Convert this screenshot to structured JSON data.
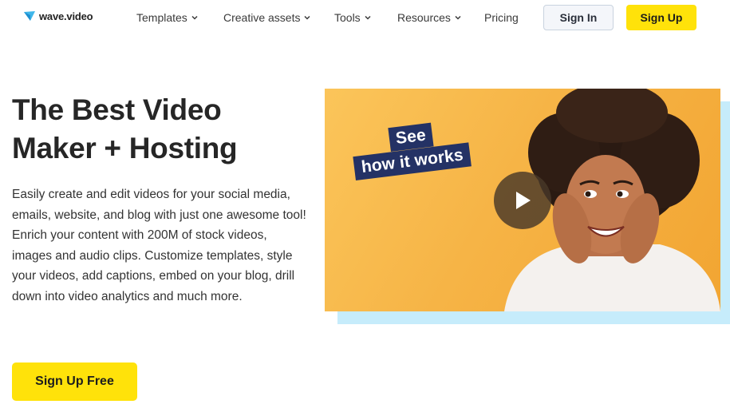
{
  "brand": {
    "name": "wave.video"
  },
  "nav": {
    "items": [
      {
        "label": "Templates",
        "has_dropdown": true
      },
      {
        "label": "Creative assets",
        "has_dropdown": true
      },
      {
        "label": "Tools",
        "has_dropdown": true
      },
      {
        "label": "Resources",
        "has_dropdown": true
      },
      {
        "label": "Pricing",
        "has_dropdown": false
      }
    ],
    "sign_in_label": "Sign In",
    "sign_up_label": "Sign Up"
  },
  "hero": {
    "title_line1": "The Best Video",
    "title_line2": "Maker + Hosting",
    "description_p1": "Easily create and edit videos for your social media, emails, website, and blog with just one awesome tool!",
    "description_p2": "Enrich your content with 200M of stock videos, images and audio clips. Customize templates, style your videos, add captions, embed on your blog, drill down into video analytics and much more.",
    "cta_label": "Sign Up Free"
  },
  "video": {
    "tag_line1": "See",
    "tag_line2": "how it works",
    "play_icon": "play-icon"
  },
  "colors": {
    "accent_yellow": "#ffe20a",
    "video_bg": "#f6b446",
    "video_shadow": "#c6ecfb",
    "tag_navy": "#243265"
  }
}
